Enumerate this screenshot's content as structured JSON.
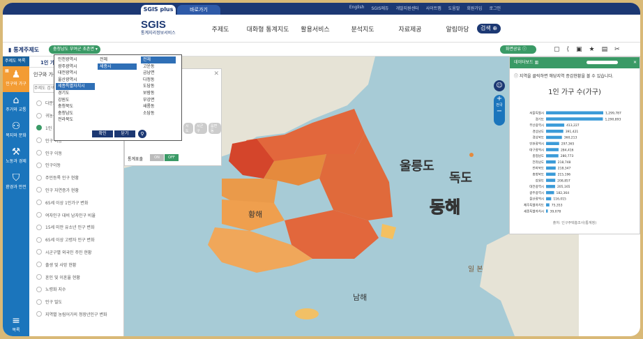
{
  "topbar": {
    "tab_sgis": "SGIS plus",
    "tab_shortcut": "바로가기",
    "links": [
      "English",
      "SGIS에듀",
      "개발지원센터",
      "사이트맵",
      "도움말",
      "회원가입",
      "로그인"
    ]
  },
  "header": {
    "logo": "SGIS",
    "logo_sub": "통계지리정보서비스",
    "nav": [
      "주제도",
      "대화형 통계지도",
      "활용서비스",
      "분석지도",
      "자료제공",
      "알림마당"
    ],
    "search_label": "검색"
  },
  "toolrow": {
    "title": "통계주제도",
    "region_label": "충청남도 부여군 초촌면",
    "share_label": "화면공유"
  },
  "sidebar": {
    "head": "주제도 목록",
    "items": [
      {
        "label": "인구와 가구",
        "icon": "people-icon"
      },
      {
        "label": "주거와 교통",
        "icon": "house-icon"
      },
      {
        "label": "복지와 문화",
        "icon": "family-icon"
      },
      {
        "label": "노동과 경제",
        "icon": "worker-icon"
      },
      {
        "label": "환경과 안전",
        "icon": "shield-icon"
      }
    ],
    "menu_label": "목록"
  },
  "listpanel": {
    "tab": "1인 가구",
    "subtitle": "인구와 가구",
    "search_placeholder": "주제도 검색",
    "rows": [
      "다문화 가구 현황",
      "귀농·귀어·귀촌",
      "1인 가구 현황",
      "인구 이동",
      "인구 이동",
      "인구이동",
      "주민등록 인구 현황",
      "인구 자연증가 현황",
      "65세 이상 1인가구 변화",
      "여자인구 대비 남자인구 비율",
      "15세 미만 유소년 인구 변화",
      "65세 이상 고령자 인구 변화",
      "시군구별 외국인 주민 현황",
      "출생 및 사망 현황",
      "혼인 및 이혼율 현황",
      "노령화 지수",
      "인구 밀도",
      "지역별 농림어가의 청장년인구 변화"
    ],
    "checked_index": 2
  },
  "settings": {
    "level_options": [
      "시도",
      "시군구",
      "읍면동"
    ],
    "stat_label": "통계표출",
    "on_label": "ON",
    "off_label": "OFF"
  },
  "dropdown": {
    "col1": [
      "인천광역시",
      "광주광역시",
      "대전광역시",
      "울산광역시",
      "세종특별자치시",
      "경기도",
      "강원도",
      "충청북도",
      "충청남도",
      "전라북도"
    ],
    "col1_selected": 4,
    "col2": [
      "전체",
      "세종시"
    ],
    "col2_selected": 1,
    "col3": [
      "전체",
      "고운동",
      "금남면",
      "다정동",
      "도담동",
      "보람동",
      "부강면",
      "새롬동",
      "소담동"
    ],
    "col3_selected": 0,
    "confirm_label": "확인",
    "close_label": "닫기"
  },
  "map": {
    "labels": {
      "ulleungdo": "울릉도",
      "dokdo": "독도",
      "east_sea": "동해",
      "yellow_sea": "황해",
      "south_sea": "남해",
      "japan": "일 본"
    },
    "zoom_label": "전국"
  },
  "rightpanel": {
    "head": "데이터보드",
    "note": "지역을 클릭하면 해당지역 증감현황을 볼 수 있습니다.",
    "source": "출처: 인구주택총조사(통계청)"
  },
  "chart_data": {
    "type": "bar",
    "title": "1인 가구 수(가구)",
    "categories": [
      "서울특별시",
      "경기도",
      "부산광역시",
      "경상남도",
      "경상북도",
      "인천광역시",
      "대구광역시",
      "충청남도",
      "전라남도",
      "전라북도",
      "충청북도",
      "강원도",
      "대전광역시",
      "광주광역시",
      "울산광역시",
      "제주특별자치도",
      "세종특별자치시"
    ],
    "values": [
      1299787,
      1290893,
      413227,
      391421,
      360213,
      297365,
      284416,
      280773,
      218748,
      218347,
      215196,
      208857,
      205165,
      182364,
      116015,
      75353,
      39078
    ],
    "labels": [
      "1,299,787",
      "1,290,893",
      "413,227",
      "391,421",
      "360,213",
      "297,365",
      "284,416",
      "280,773",
      "218,748",
      "218,347",
      "215,196",
      "208,857",
      "205,165",
      "182,364",
      "116,015",
      "75,353",
      "39,078"
    ],
    "bar_color": "#3b9bd8"
  }
}
